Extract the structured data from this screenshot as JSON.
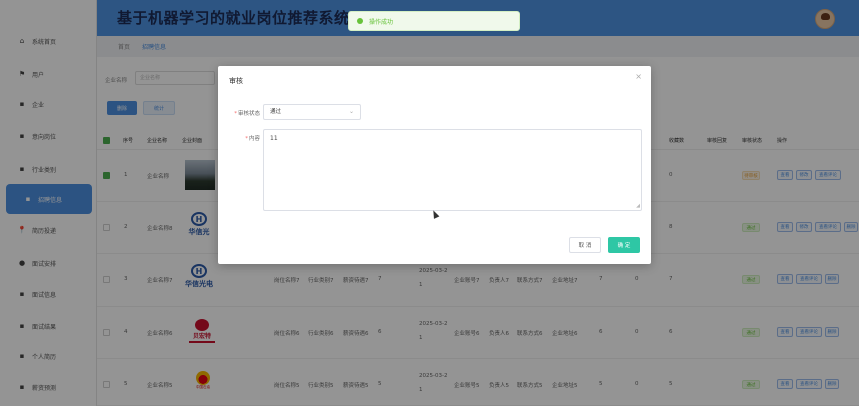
{
  "header": {
    "title": "基于机器学习的就业岗位推荐系统"
  },
  "toast": {
    "text": "操作成功"
  },
  "sidebar": {
    "items": [
      {
        "label": "系统首页",
        "icon": "home-icon"
      },
      {
        "label": "用户",
        "icon": "flag-icon"
      },
      {
        "label": "企业",
        "icon": "grid-icon"
      },
      {
        "label": "意向岗位",
        "icon": "grid-icon"
      },
      {
        "label": "行业类别",
        "icon": "grid-icon"
      },
      {
        "label": "招聘信息",
        "icon": "grid-icon"
      },
      {
        "label": "简历投递",
        "icon": "pin-icon"
      },
      {
        "label": "面试安排",
        "icon": "dot-icon"
      },
      {
        "label": "面试信息",
        "icon": "grid-icon"
      },
      {
        "label": "面试结果",
        "icon": "grid-icon"
      },
      {
        "label": "个人简历",
        "icon": "grid-icon"
      },
      {
        "label": "薪资预测",
        "icon": "grid-icon"
      }
    ]
  },
  "breadcrumb": {
    "home": "首页",
    "current": "招聘信息"
  },
  "search": {
    "label": "企业名称",
    "placeholder": "企业名称"
  },
  "toolbar": {
    "delete_label": "删除",
    "stat_label": "统计"
  },
  "table": {
    "headers": {
      "index": "序号",
      "company": "企业名称",
      "cover": "企业封面",
      "favorites": "收藏数",
      "reply": "审核回复",
      "status": "审核状态",
      "ops": "操作"
    },
    "rows": [
      {
        "idx": "1",
        "company": "企业名称",
        "logo": "photo",
        "extra": "",
        "favorites": "0",
        "status": "待审核",
        "status_type": "pending"
      },
      {
        "idx": "2",
        "company": "企业名称8",
        "logo": "hxg",
        "logo_text": "华信光",
        "extra": "",
        "favorites": "8",
        "status": "通过",
        "status_type": "pass"
      },
      {
        "idx": "3",
        "company": "企业名称7",
        "logo": "hxg",
        "logo_text": "华信光电",
        "position": "岗位名称7",
        "industry": "行业类别7",
        "salary": "薪资待遇7",
        "num": "7",
        "date1": "2025-03-2",
        "date2": "1",
        "acct": "企业账号7",
        "person": "负责人7",
        "contact": "联系方式7",
        "addr": "企业地址7",
        "n2": "7",
        "n3": "0",
        "favorites": "7",
        "status": "通过",
        "status_type": "pass"
      },
      {
        "idx": "4",
        "company": "企业名称6",
        "logo": "bei",
        "logo_text": "贝宏特",
        "position": "岗位名称6",
        "industry": "行业类别6",
        "salary": "薪资待遇6",
        "num": "6",
        "date1": "2025-03-2",
        "date2": "1",
        "acct": "企业账号6",
        "person": "负责人6",
        "contact": "联系方式6",
        "addr": "企业地址6",
        "n2": "6",
        "n3": "0",
        "favorites": "6",
        "status": "通过",
        "status_type": "pass"
      },
      {
        "idx": "5",
        "company": "企业名称5",
        "logo": "zsy",
        "logo_text": "中国石油",
        "position": "岗位名称5",
        "industry": "行业类别5",
        "salary": "薪资待遇5",
        "num": "5",
        "date1": "2025-03-2",
        "date2": "1",
        "acct": "企业账号5",
        "person": "负责人5",
        "contact": "联系方式5",
        "addr": "企业地址5",
        "n2": "5",
        "n3": "0",
        "favorites": "5",
        "status": "通过",
        "status_type": "pass"
      }
    ],
    "ops": [
      "查看",
      "修改",
      "查看评论",
      "删除"
    ]
  },
  "modal": {
    "title": "审核",
    "status_label": "审核状态",
    "status_value": "通过",
    "content_label": "内容",
    "content_value": "11",
    "cancel_label": "取 消",
    "ok_label": "确 定"
  }
}
